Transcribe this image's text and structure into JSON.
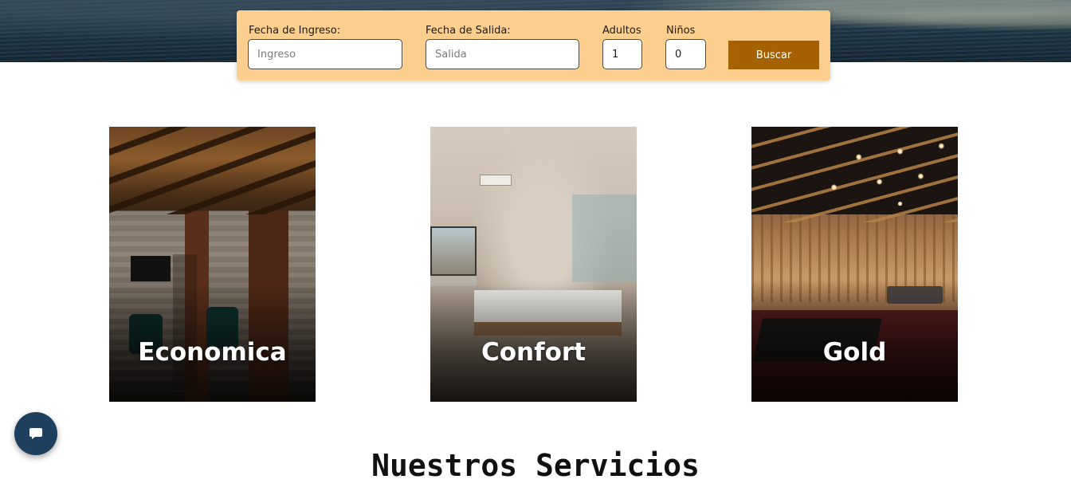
{
  "booking": {
    "checkin_label": "Fecha de Ingreso:",
    "checkin_placeholder": "Ingreso",
    "checkout_label": "Fecha de Salida:",
    "checkout_placeholder": "Salida",
    "adults_label": "Adultos",
    "adults_value": "1",
    "children_label": "Niños",
    "children_value": "0",
    "search_label": "Buscar",
    "colors": {
      "bar": "#fdcf8e",
      "button": "#a66100"
    }
  },
  "rooms": [
    {
      "title": "Economica"
    },
    {
      "title": "Confort"
    },
    {
      "title": "Gold"
    }
  ],
  "chat": {
    "icon": "chat-bubble-icon",
    "color": "#1f3f5e"
  },
  "services": {
    "heading": "Nuestros Servicios"
  }
}
